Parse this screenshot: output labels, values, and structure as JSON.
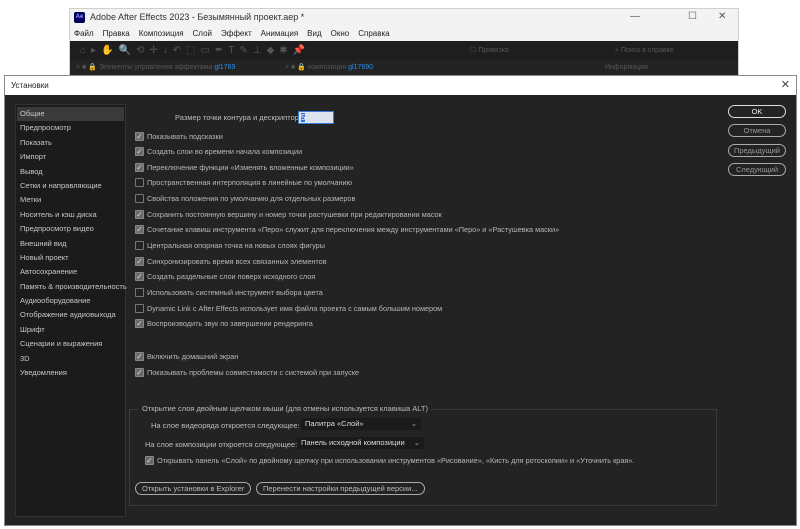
{
  "app_window": {
    "logo": "Ae",
    "title": "Adobe After Effects 2023 - Безымянный проект.aep *",
    "menu": [
      "Файл",
      "Правка",
      "Композиция",
      "Слой",
      "Эффект",
      "Анимация",
      "Вид",
      "Окно",
      "Справка"
    ],
    "snap_label": "Привязка",
    "help_search": "Поиск в справке",
    "tabs": {
      "effects": "Элементы управления эффектами",
      "effects_target": "gl1769",
      "comp": "композиция",
      "comp_target": "gl17690",
      "info": "Информация"
    }
  },
  "dialog": {
    "title": "Установки",
    "sidebar": [
      "Общие",
      "Предпросмотр",
      "Показать",
      "Импорт",
      "Вывод",
      "Сетки и направляющие",
      "Метки",
      "Носитель и кэш диска",
      "Предпросмотр видео",
      "Внешний вид",
      "Новый проект",
      "Автосохранение",
      "Память & производительность",
      "Аудиооборудование",
      "Отображение аудиовыхода",
      "Шрифт",
      "Сценарии и выражения",
      "3D",
      "Уведомления"
    ],
    "selected": "Общие",
    "path_point_label": "Размер точки контура и дескриптора:",
    "path_point_value": "5",
    "options": [
      {
        "label": "Показывать подсказки",
        "checked": true
      },
      {
        "label": "Создать слои во времени начала композиции",
        "checked": true
      },
      {
        "label": "Переключение функции «Изменять вложенные композиции»",
        "checked": true
      },
      {
        "label": "Пространственная интерполяция в линейные по умолчанию",
        "checked": false
      },
      {
        "label": "Свойства положения по умолчанию для отдельных размеров",
        "checked": false
      },
      {
        "label": "Сохранить постоянную вершину и номер точки растушевки при редактировании масок",
        "checked": true
      },
      {
        "label": "Сочетание клавиш инструмента «Перо» служит для переключения между инструментами «Перо» и «Растушевка маски»",
        "checked": true
      },
      {
        "label": "Центральная опорная точка на новых слоях фигуры",
        "checked": false
      },
      {
        "label": "Синхронизировать время всех связанных элементов",
        "checked": true
      },
      {
        "label": "Создать раздельные слои поверх исходного слоя",
        "checked": true
      },
      {
        "label": "Использовать системный инструмент выбора цвета",
        "checked": false
      },
      {
        "label": "Dynamic Link с After Effects использует имя файла проекта с самым большим номером",
        "checked": false
      },
      {
        "label": "Воспроизводить звук по завершении рендеринга",
        "checked": true
      }
    ],
    "options2": [
      {
        "label": "Включить домашний экран",
        "checked": true
      },
      {
        "label": "Показывать проблемы совместимости с системой при запуске",
        "checked": true
      }
    ],
    "group": {
      "title": "Открытие слоя двойным щелчком мыши (для отмены используется клавиша ALT)",
      "footage_label": "На слое видеоряда откроется следующее:",
      "footage_value": "Палитра «Слой»",
      "comp_label": "На слое композиции откроется следующее:",
      "comp_value": "Панель исходной композиции",
      "paint_label": "Открывать панель «Слой» по двойному щелчку при использовании инструментов «Рисование», «Кисть для ротоскопии» и «Уточнить края».",
      "paint_checked": true
    },
    "buttons": {
      "ok": "OK",
      "cancel": "Отмена",
      "prev": "Предыдущий",
      "next": "Следующий",
      "explorer": "Открыть установки в Explorer",
      "migrate": "Перенести настройки предыдущей версии..."
    }
  }
}
